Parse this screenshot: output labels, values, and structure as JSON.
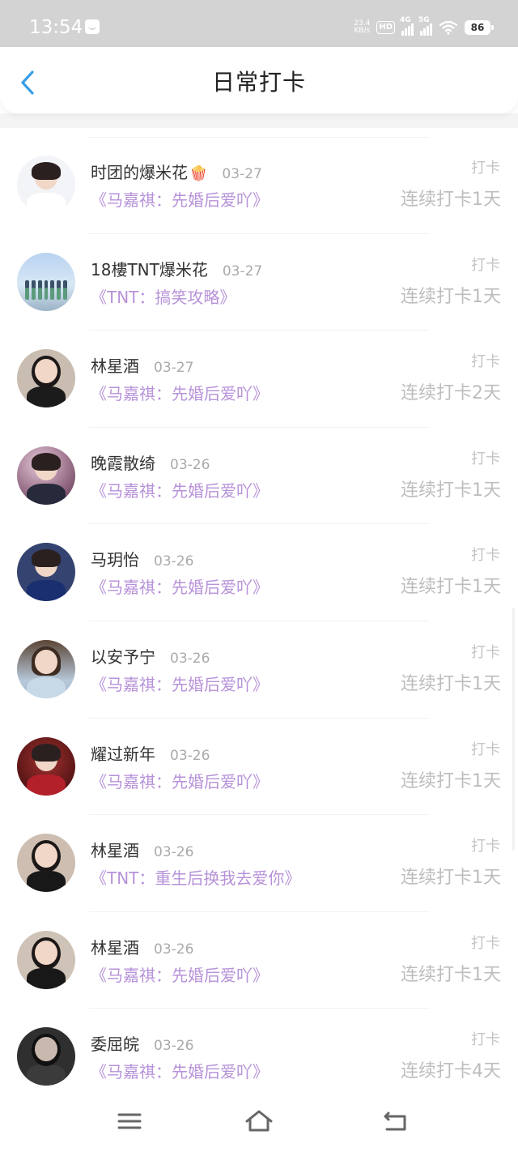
{
  "status_bar": {
    "time": "13:54",
    "net_speed_value": "23.4",
    "net_speed_unit": "KB/s",
    "hd_label": "HD",
    "signal1_label": "4G",
    "signal2_label": "5G",
    "battery": "86"
  },
  "header": {
    "title": "日常打卡"
  },
  "checkins": [
    {
      "user": "时团的爆米花",
      "emoji": "🍿",
      "date": "03-27",
      "book": "《马嘉祺：先婚后爱吖》",
      "action": "打卡",
      "streak": "连续打卡1天"
    },
    {
      "user": "18樓TNT爆米花",
      "emoji": "",
      "date": "03-27",
      "book": "《TNT：搞笑攻略》",
      "action": "打卡",
      "streak": "连续打卡1天"
    },
    {
      "user": "林星酒",
      "emoji": "",
      "date": "03-27",
      "book": "《马嘉祺：先婚后爱吖》",
      "action": "打卡",
      "streak": "连续打卡2天"
    },
    {
      "user": "晚霞散绮",
      "emoji": "",
      "date": "03-26",
      "book": "《马嘉祺：先婚后爱吖》",
      "action": "打卡",
      "streak": "连续打卡1天"
    },
    {
      "user": "马玥怡",
      "emoji": "",
      "date": "03-26",
      "book": "《马嘉祺：先婚后爱吖》",
      "action": "打卡",
      "streak": "连续打卡1天"
    },
    {
      "user": "以安予宁",
      "emoji": "",
      "date": "03-26",
      "book": "《马嘉祺：先婚后爱吖》",
      "action": "打卡",
      "streak": "连续打卡1天"
    },
    {
      "user": "耀过新年",
      "emoji": "",
      "date": "03-26",
      "book": "《马嘉祺：先婚后爱吖》",
      "action": "打卡",
      "streak": "连续打卡1天"
    },
    {
      "user": "林星酒",
      "emoji": "",
      "date": "03-26",
      "book": "《TNT：重生后换我去爱你》",
      "action": "打卡",
      "streak": "连续打卡1天"
    },
    {
      "user": "林星酒",
      "emoji": "",
      "date": "03-26",
      "book": "《马嘉祺：先婚后爱吖》",
      "action": "打卡",
      "streak": "连续打卡1天"
    },
    {
      "user": "委屈皖",
      "emoji": "",
      "date": "03-26",
      "book": "《马嘉祺：先婚后爱吖》",
      "action": "打卡",
      "streak": "连续打卡4天"
    }
  ],
  "colors": {
    "accent": "#3a9ee6",
    "book_title": "#b792d9",
    "muted_text": "#bdbdbd"
  },
  "icons": {
    "back": "chevron-left-icon",
    "menu": "menu-icon",
    "home": "home-icon",
    "return": "return-icon"
  }
}
